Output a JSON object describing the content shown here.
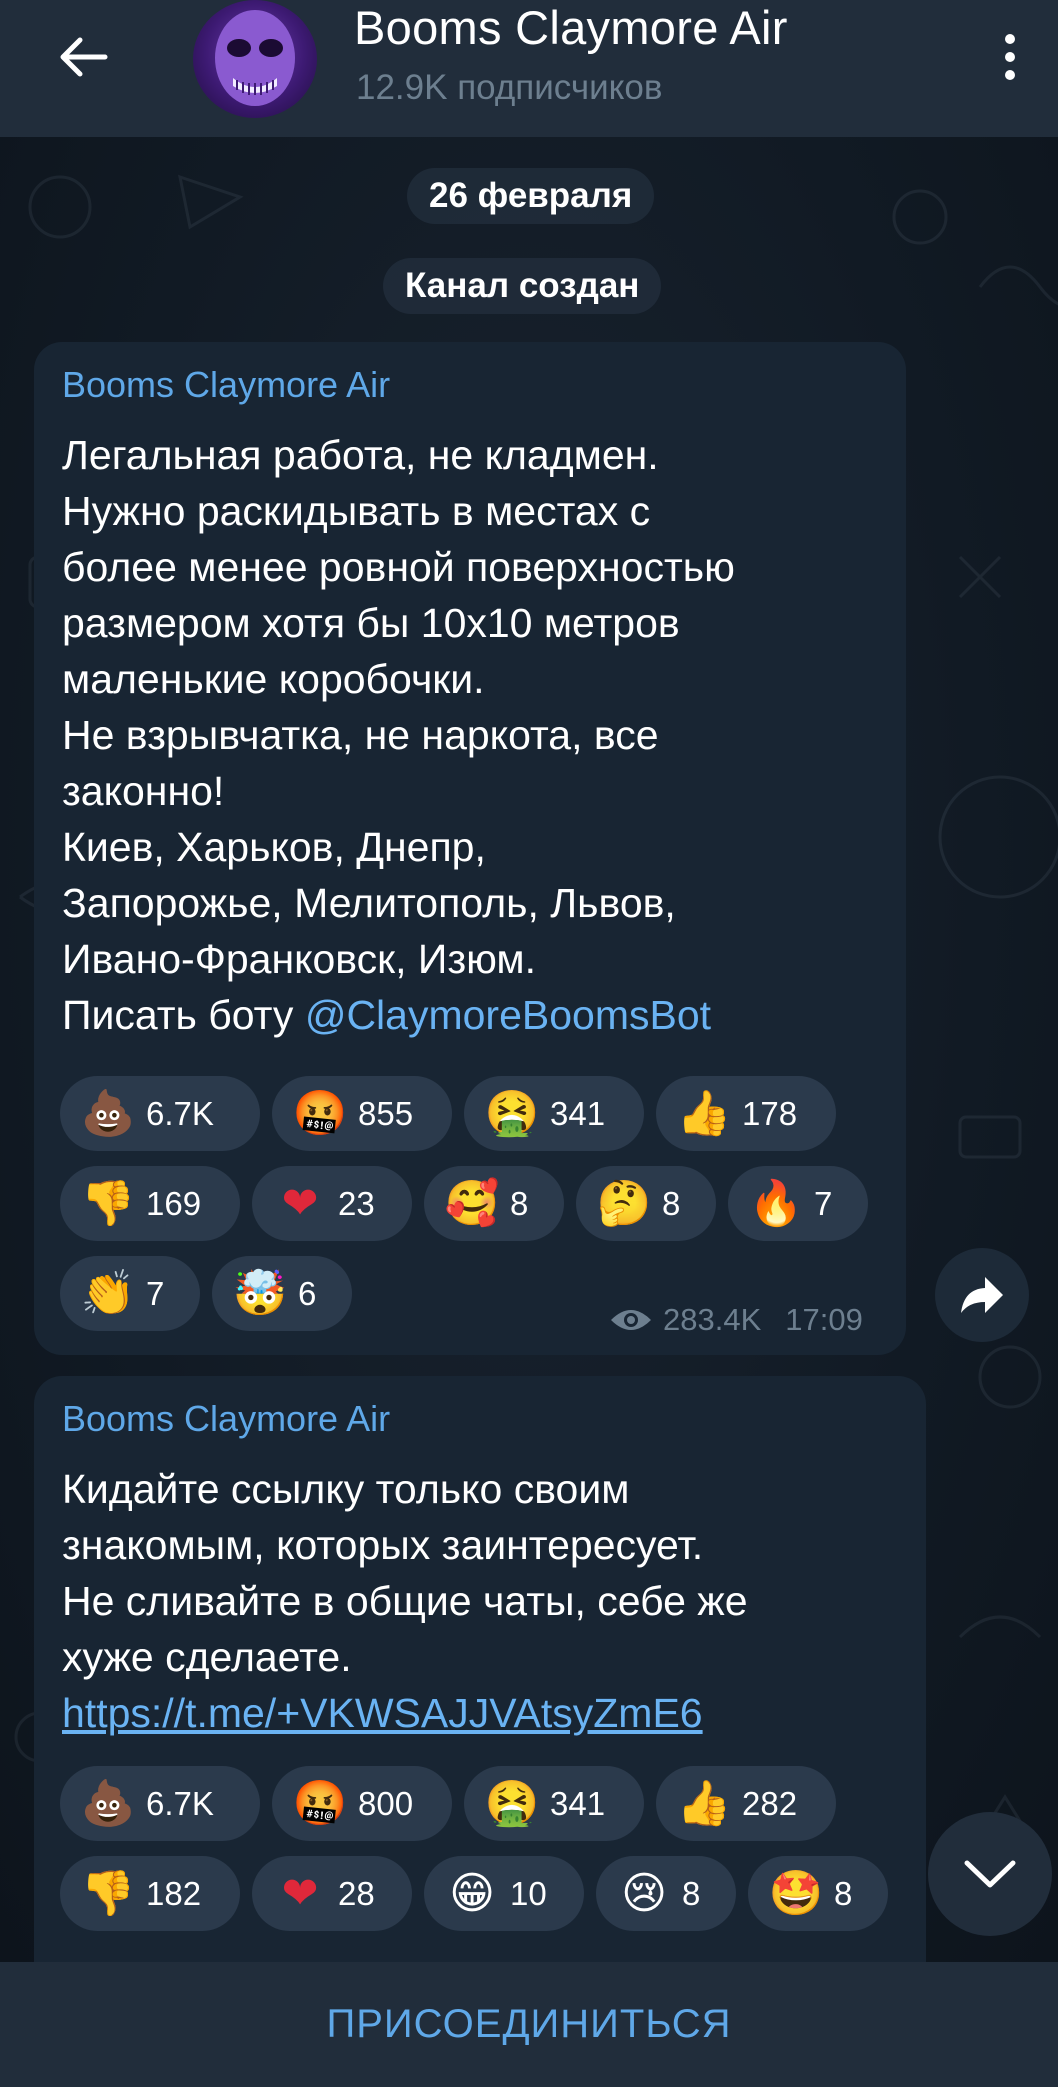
{
  "header": {
    "title": "Booms Claymore Air",
    "subscribers": "12.9K подписчиков",
    "icons": {
      "back": "arrow-left-icon",
      "menu": "more-vertical-icon"
    }
  },
  "service": {
    "date": "26 февраля",
    "created": "Канал создан"
  },
  "messages": [
    {
      "author": "Booms Claymore Air",
      "text": "Легальная работа, не кладмен.\nНужно раскидывать в местах с\nболее менее ровной поверхностью\nразмером хотя бы 10х10 метров\nмаленькие коробочки.\nНе взрывчатка, не наркота, все\nзаконно!\nКиев, Харьков, Днепр,\nЗапорожье, Мелитополь, Львов,\nИвано-Франковск, Изюм.\nПисать боту ",
      "mention": "@ClaymoreBoomsBot",
      "reactions": [
        {
          "emoji": "💩",
          "icon": "poop-emoji",
          "count": "6.7K"
        },
        {
          "emoji": "🤬",
          "icon": "cursing-face-emoji",
          "count": "855"
        },
        {
          "emoji": "🤮",
          "icon": "vomiting-face-emoji",
          "count": "341"
        },
        {
          "emoji": "👍",
          "icon": "thumbs-up-emoji",
          "count": "178"
        },
        {
          "emoji": "👎",
          "icon": "thumbs-down-emoji",
          "count": "169"
        },
        {
          "emoji": "❤",
          "icon": "heart-emoji",
          "count": "23"
        },
        {
          "emoji": "🥰",
          "icon": "smiling-hearts-emoji",
          "count": "8"
        },
        {
          "emoji": "🤔",
          "icon": "thinking-face-emoji",
          "count": "8"
        },
        {
          "emoji": "🔥",
          "icon": "fire-emoji",
          "count": "7"
        },
        {
          "emoji": "👏",
          "icon": "clapping-hands-emoji",
          "count": "7"
        },
        {
          "emoji": "🤯",
          "icon": "exploding-head-emoji",
          "count": "6"
        }
      ],
      "views": "283.4K",
      "time": "17:09"
    },
    {
      "author": "Booms Claymore Air",
      "text": "Кидайте ссылку только своим\nзнакомым, которых заинтересует.\nНе сливайте в общие чаты, себе же\nхуже сделаете.",
      "url": "https://t.me/+VKWSAJJVAtsyZmE6",
      "reactions": [
        {
          "emoji": "💩",
          "icon": "poop-emoji",
          "count": "6.7K"
        },
        {
          "emoji": "🤬",
          "icon": "cursing-face-emoji",
          "count": "800"
        },
        {
          "emoji": "🤮",
          "icon": "vomiting-face-emoji",
          "count": "341"
        },
        {
          "emoji": "👍",
          "icon": "thumbs-up-emoji",
          "count": "282"
        },
        {
          "emoji": "👎",
          "icon": "thumbs-down-emoji",
          "count": "182"
        },
        {
          "emoji": "❤",
          "icon": "heart-emoji",
          "count": "28"
        },
        {
          "emoji": "😁",
          "icon": "grinning-face-emoji",
          "count": "10"
        },
        {
          "emoji": "😢",
          "icon": "crying-face-emoji",
          "count": "8"
        },
        {
          "emoji": "🤩",
          "icon": "star-struck-emoji",
          "count": "8"
        }
      ]
    }
  ],
  "bottom": {
    "join_label": "ПРИСОЕДИНИТЬСЯ"
  },
  "colors": {
    "header_bg": "#212d3b",
    "bubble_bg": "#182533",
    "accent": "#5fa8e8",
    "muted": "#6d7f8f"
  }
}
